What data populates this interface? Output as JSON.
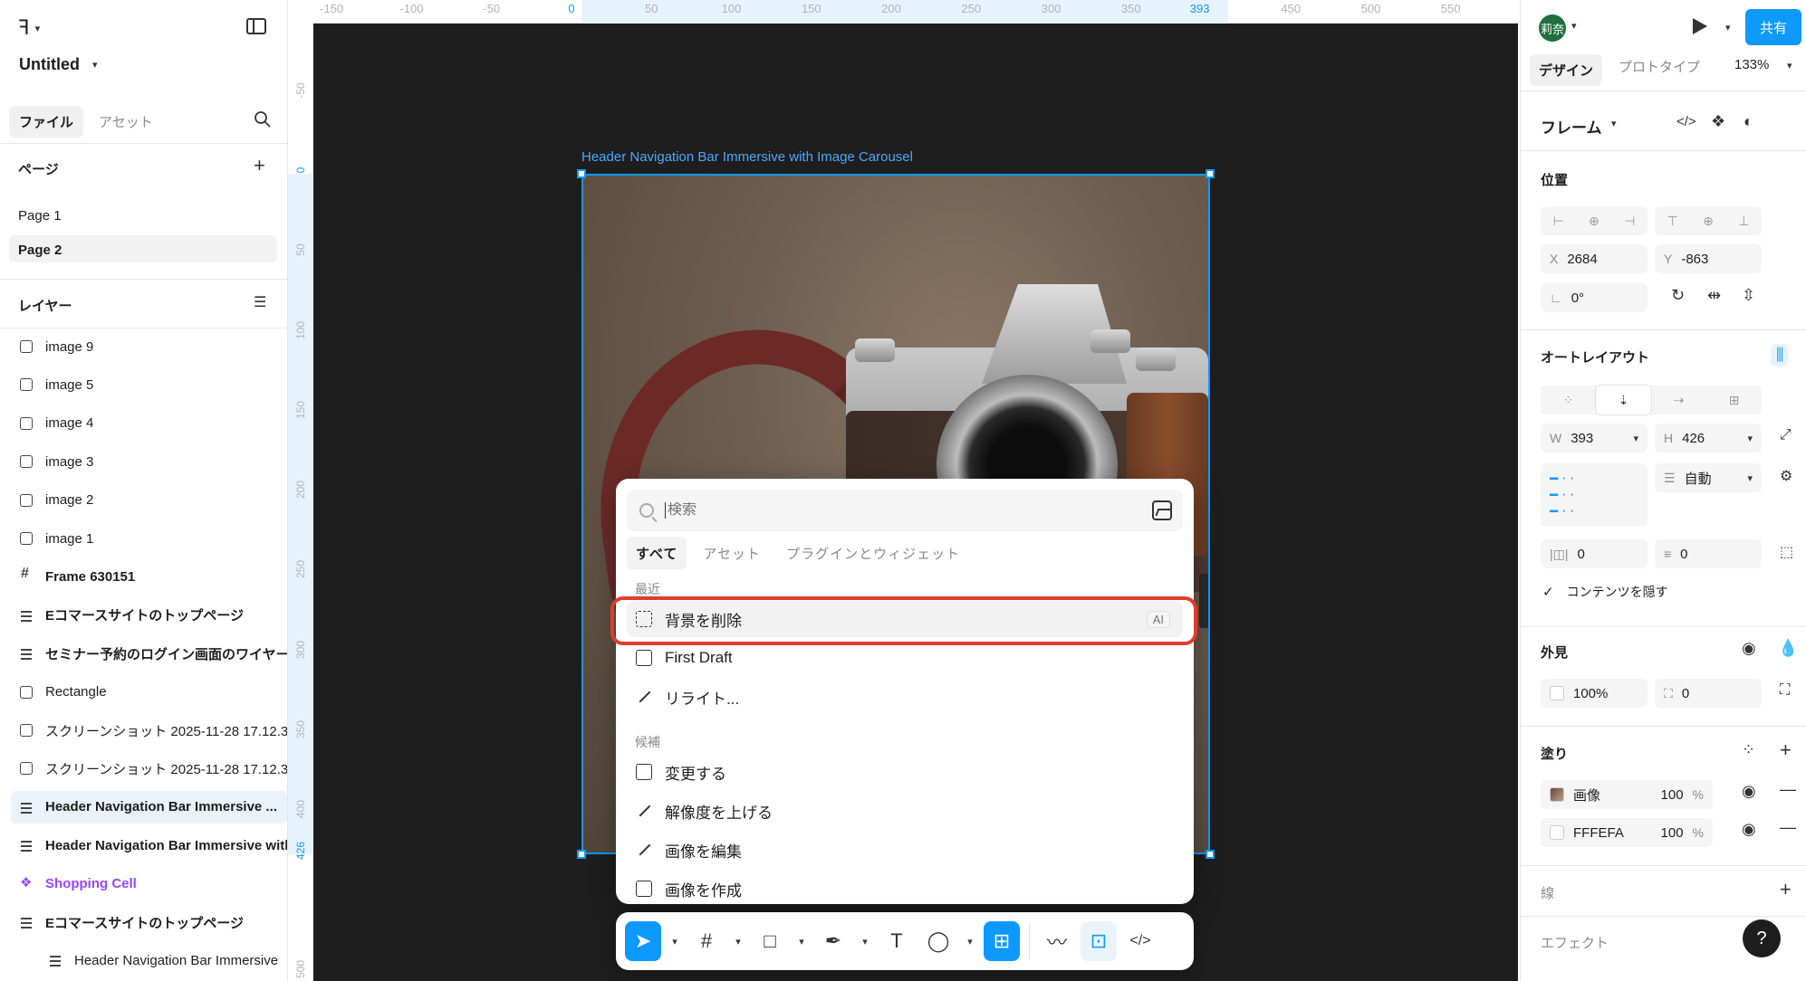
{
  "file": {
    "title": "Untitled"
  },
  "left_tabs": [
    "ファイル",
    "アセット"
  ],
  "pages": {
    "header": "ページ",
    "items": [
      "Page 1",
      "Page 2"
    ]
  },
  "layers": {
    "header": "レイヤー",
    "items": [
      {
        "label": "image 9",
        "icon": "image-icon"
      },
      {
        "label": "image 5",
        "icon": "image-icon"
      },
      {
        "label": "image 4",
        "icon": "image-icon"
      },
      {
        "label": "image 3",
        "icon": "image-icon"
      },
      {
        "label": "image 2",
        "icon": "image-icon"
      },
      {
        "label": "image 1",
        "icon": "image-icon"
      },
      {
        "label": "Frame 630151",
        "icon": "frame-icon"
      },
      {
        "label": "Eコマースサイトのトップページ",
        "icon": "auto-layout-icon"
      },
      {
        "label": "セミナー予約のログイン画面のワイヤーフ",
        "icon": "auto-layout-icon"
      },
      {
        "label": "Rectangle",
        "icon": "image-icon"
      },
      {
        "label": "スクリーンショット 2025-11-28 17.12.3",
        "icon": "image-icon"
      },
      {
        "label": "スクリーンショット 2025-11-28 17.12.3",
        "icon": "image-icon"
      },
      {
        "label": "Header Navigation Bar Immersive ...",
        "icon": "auto-layout-icon"
      },
      {
        "label": "Header Navigation Bar Immersive with",
        "icon": "auto-layout-icon"
      },
      {
        "label": "Shopping Cell",
        "icon": "component-icon"
      },
      {
        "label": "Eコマースサイトのトップページ",
        "icon": "auto-layout-icon"
      },
      {
        "label": "Header Navigation Bar Immersive",
        "icon": "auto-layout-icon"
      }
    ]
  },
  "ruler": {
    "top": [
      "-150",
      "-100",
      "-50",
      "0",
      "50",
      "100",
      "150",
      "200",
      "250",
      "300",
      "350",
      "393",
      "450",
      "500",
      "550"
    ],
    "left": [
      "-50",
      "0",
      "50",
      "100",
      "150",
      "200",
      "250",
      "300",
      "350",
      "400",
      "426",
      "500"
    ]
  },
  "canvas": {
    "frame_label": "Header Navigation Bar Immersive with Image Carousel"
  },
  "popup": {
    "search_placeholder": "検索",
    "tabs": [
      "すべて",
      "アセット",
      "プラグインとウィジェット"
    ],
    "recent_label": "最近",
    "suggest_label": "候補",
    "recent": [
      {
        "label": "背景を削除",
        "badge": "AI",
        "icon": "remove-background-icon"
      },
      {
        "label": "First Draft",
        "icon": "first-draft-icon"
      },
      {
        "label": "リライト...",
        "icon": "rewrite-icon"
      }
    ],
    "suggestions": [
      {
        "label": "変更する",
        "icon": "modify-icon"
      },
      {
        "label": "解像度を上げる",
        "icon": "upscale-icon"
      },
      {
        "label": "画像を編集",
        "icon": "edit-image-icon"
      },
      {
        "label": "画像を作成",
        "icon": "create-image-icon"
      }
    ]
  },
  "right": {
    "avatar": "莉奈",
    "share": "共有",
    "tabs": [
      "デザイン",
      "プロトタイプ"
    ],
    "zoom": "133%",
    "frame_title": "フレーム",
    "position": {
      "label": "位置",
      "x": "2684",
      "y": "-863",
      "rotation": "0°"
    },
    "autolayout": {
      "label": "オートレイアウト",
      "w": "393",
      "h": "426",
      "gap": "自動",
      "padding_h": "0",
      "padding_v": "0",
      "clip": "コンテンツを隠す"
    },
    "appearance": {
      "label": "外見",
      "opacity": "100%",
      "radius": "0"
    },
    "fill": {
      "label": "塗り",
      "items": [
        {
          "name": "画像",
          "opacity": "100",
          "unit": "%"
        },
        {
          "name": "FFFEFA",
          "opacity": "100",
          "unit": "%"
        }
      ]
    },
    "stroke": {
      "label": "線"
    },
    "effects": {
      "label": "エフェクト"
    },
    "help": "?"
  },
  "colors": {
    "accent": "#0d99ff",
    "highlight": "#e03d2d",
    "canvas": "#1e1e1e",
    "component": "#9747ff"
  }
}
